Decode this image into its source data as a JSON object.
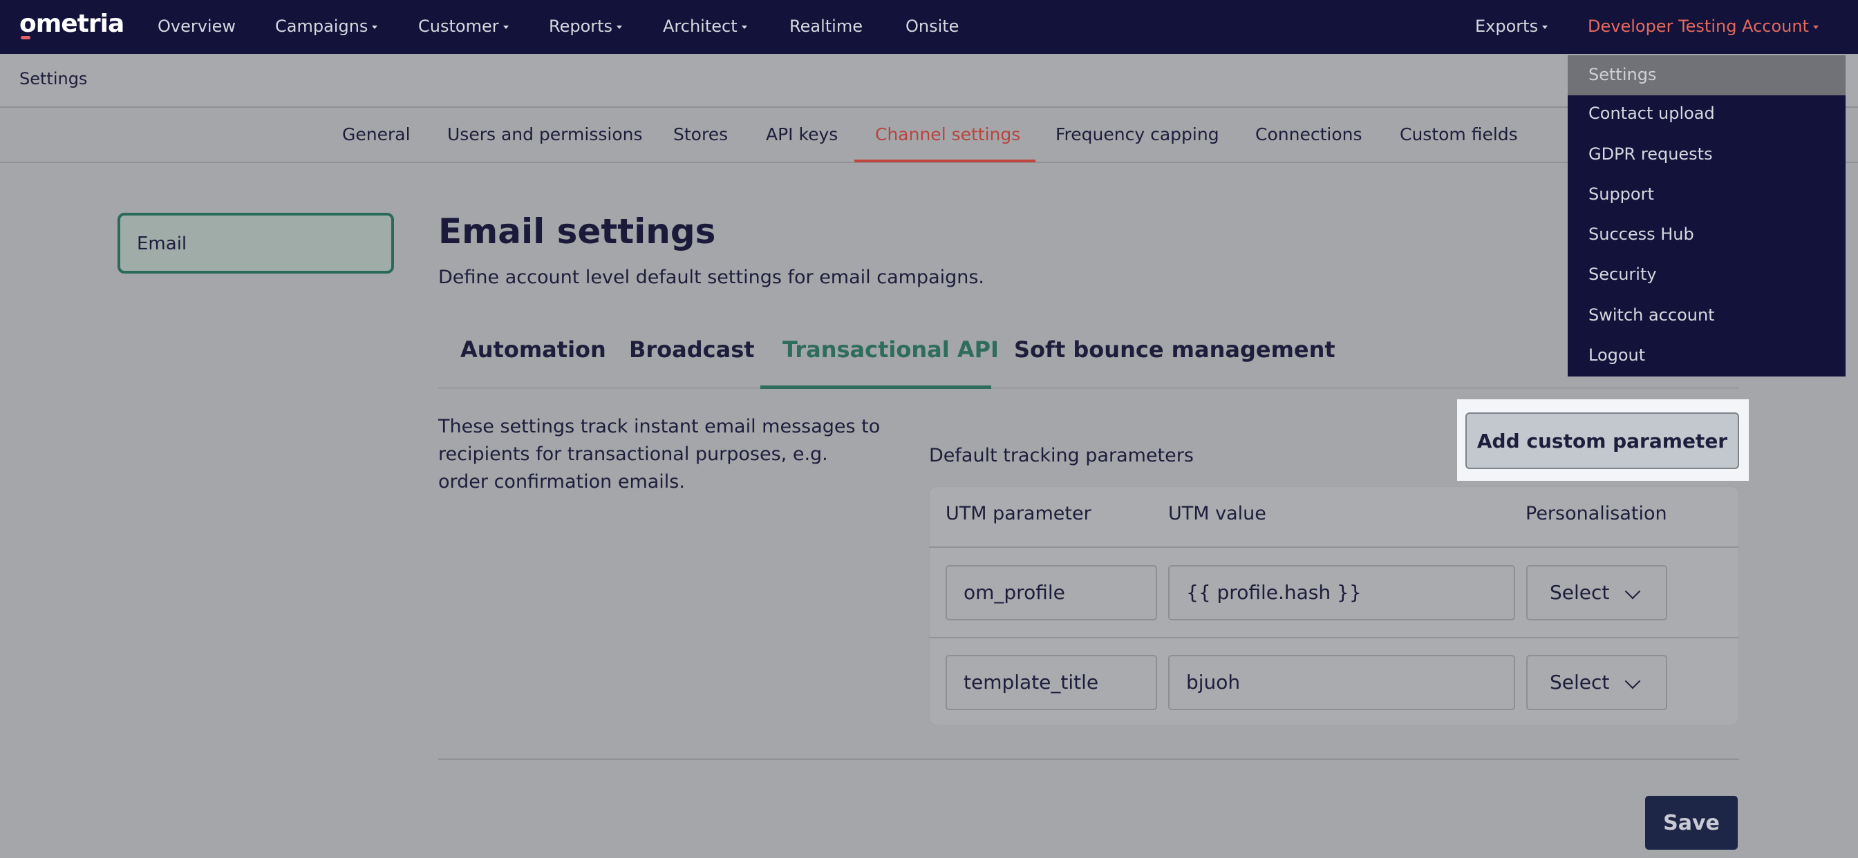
{
  "topnav": {
    "logo": "ometria",
    "items": [
      "Overview",
      "Campaigns",
      "Customer",
      "Reports",
      "Architect",
      "Realtime",
      "Onsite"
    ],
    "exports": "Exports",
    "account": "Developer Testing Account"
  },
  "subheader": {
    "title": "Settings"
  },
  "settings_tabs": [
    "General",
    "Users and permissions",
    "Stores",
    "API keys",
    "Channel settings",
    "Frequency capping",
    "Connections",
    "Custom fields"
  ],
  "leftnav": {
    "email": "Email"
  },
  "main": {
    "title": "Email settings",
    "description": "Define account level default settings for email campaigns.",
    "tabs": [
      "Automation",
      "Broadcast",
      "Transactional API",
      "Soft bounce management"
    ],
    "info": "These settings track instant email messages to recipients for transactional purposes, e.g. order confirmation emails.",
    "default_params_label": "Default tracking parameters",
    "add_button": "Add custom parameter",
    "table": {
      "headers": [
        "UTM parameter",
        "UTM value",
        "Personalisation"
      ],
      "rows": [
        {
          "param": "om_profile",
          "value": "{{ profile.hash }}",
          "personalisation": "Select"
        },
        {
          "param": "template_title",
          "value": "bjuoh",
          "personalisation": "Select"
        }
      ]
    },
    "save": "Save"
  },
  "dropdown": {
    "items": [
      "Settings",
      "Contact upload",
      "GDPR requests",
      "Support",
      "Success Hub",
      "Security",
      "Switch account",
      "Logout"
    ]
  },
  "colors": {
    "nav_bg": "#13123a",
    "accent_red": "#c0473f",
    "accent_green": "#2e6c5c",
    "save_bg": "#1e2647"
  }
}
